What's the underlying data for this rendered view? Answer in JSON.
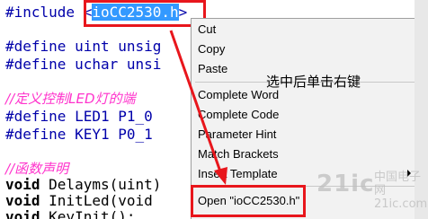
{
  "editor": {
    "line1_prefix": "#include <",
    "line1_selected": "ioCC2530.h",
    "line1_suffix": ">",
    "line2": "#define uint unsig",
    "line3": "#define uchar unsi",
    "line4_comment": "//定义控制LED灯的端",
    "line5": "#define LED1 P1_0",
    "line6": "#define KEY1 P0_1",
    "line7_comment": "//函数声明",
    "line8_kw": "void",
    "line8_rest": " Delayms(uint)",
    "line9_kw": "void",
    "line9_rest": " InitLed(void",
    "line10_kw": "void",
    "line10_rest": " KeyInit();"
  },
  "context_menu": {
    "items": [
      {
        "label": "Cut"
      },
      {
        "label": "Copy"
      },
      {
        "label": "Paste"
      },
      {
        "label": "Complete Word"
      },
      {
        "label": "Complete Code"
      },
      {
        "label": "Parameter Hint"
      },
      {
        "label": "Match Brackets"
      },
      {
        "label": "Insert Template"
      },
      {
        "label": "Open \"ioCC2530.h\""
      }
    ]
  },
  "annotation": "选中后单击右键",
  "watermark": {
    "logo": "21ic",
    "text_line1": "中国电子网",
    "text_line2": "21ic.com"
  },
  "colors": {
    "highlight_box": "#e8161c",
    "selection": "#3399ff",
    "macro_text": "#0000aa",
    "comment_text": "#ff33cc"
  }
}
